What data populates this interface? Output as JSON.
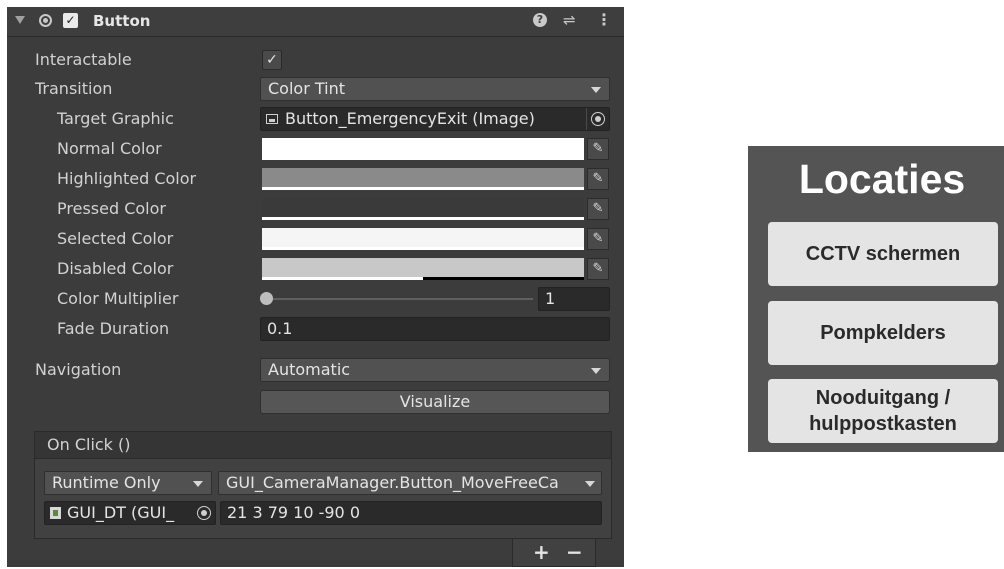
{
  "inspector": {
    "component_title": "Button",
    "header_icons": [
      "collapse-triangle-icon",
      "radio-icon",
      "enabled-check-icon",
      "help-icon",
      "preset-icon",
      "kebab-menu-icon"
    ],
    "fields": {
      "interactable": {
        "label": "Interactable",
        "checked": true
      },
      "transition": {
        "label": "Transition",
        "value": "Color Tint"
      },
      "target_graphic": {
        "label": "Target Graphic",
        "value": "Button_EmergencyExit (Image)"
      },
      "normal_color": {
        "label": "Normal Color",
        "color": "#ffffff",
        "alpha": 1.0
      },
      "highlighted_color": {
        "label": "Highlighted Color",
        "color": "#8a8a8a",
        "alpha": 1.0
      },
      "pressed_color": {
        "label": "Pressed Color",
        "color": "#3a3a3a",
        "alpha": 1.0
      },
      "selected_color": {
        "label": "Selected Color",
        "color": "#f5f5f5",
        "alpha": 1.0
      },
      "disabled_color": {
        "label": "Disabled Color",
        "color": "#c8c8c8",
        "alpha": 0.5
      },
      "color_multiplier": {
        "label": "Color Multiplier",
        "value": "1",
        "slider_fraction": 0.0
      },
      "fade_duration": {
        "label": "Fade Duration",
        "value": "0.1"
      },
      "navigation": {
        "label": "Navigation",
        "value": "Automatic"
      },
      "visualize_label": "Visualize"
    },
    "on_click": {
      "header": "On Click ()",
      "runtime": "Runtime Only",
      "function": "GUI_CameraManager.Button_MoveFreeCa",
      "object": "GUI_DT (GUI_",
      "argument": "21 3 79 10 -90 0",
      "add_label": "+",
      "remove_label": "−"
    }
  },
  "preview": {
    "title": "Locaties",
    "buttons": [
      {
        "label": "CCTV schermen"
      },
      {
        "label": "Pompkelders"
      },
      {
        "label_line1": "Nooduitgang /",
        "label_line2": "hulppostkasten"
      }
    ]
  }
}
